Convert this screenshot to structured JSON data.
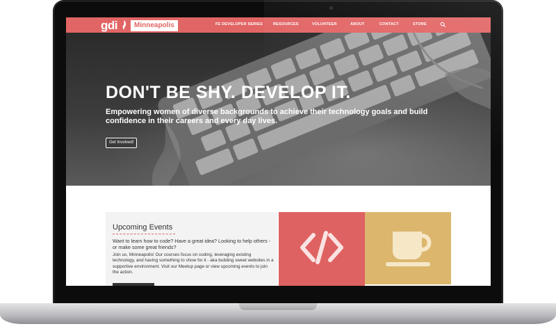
{
  "brand": {
    "logo_text": "gdi",
    "chapter": "Minneapolis",
    "accent": "#e26565",
    "gold": "#dbb66c"
  },
  "nav": {
    "items": [
      "FE DEVELOPER SERIES",
      "RESOURCES",
      "VOLUNTEER",
      "ABOUT",
      "CONTACT",
      "STORE"
    ],
    "search_icon": "search-icon"
  },
  "hero": {
    "title": "DON'T BE SHY. DEVELOP IT.",
    "subtitle": "Empowering women of diverse backgrounds to achieve their technology goals and build confidence in their careers and every day lives.",
    "button": "Get Involved!"
  },
  "events": {
    "title": "Upcoming Events",
    "lead": "Want to learn how to code? Have a great idea? Looking to help others - or make some great friends?",
    "body": "Join us, Minneapolis! Our courses focus on coding, leveraging existing technology, and having something to show for it - aka building sweet websites in a supportive environment. Visit our Meetup page or view upcoming events to join the action."
  },
  "tiles": [
    {
      "icon": "code-icon"
    },
    {
      "icon": "coffee-cup-icon"
    }
  ]
}
